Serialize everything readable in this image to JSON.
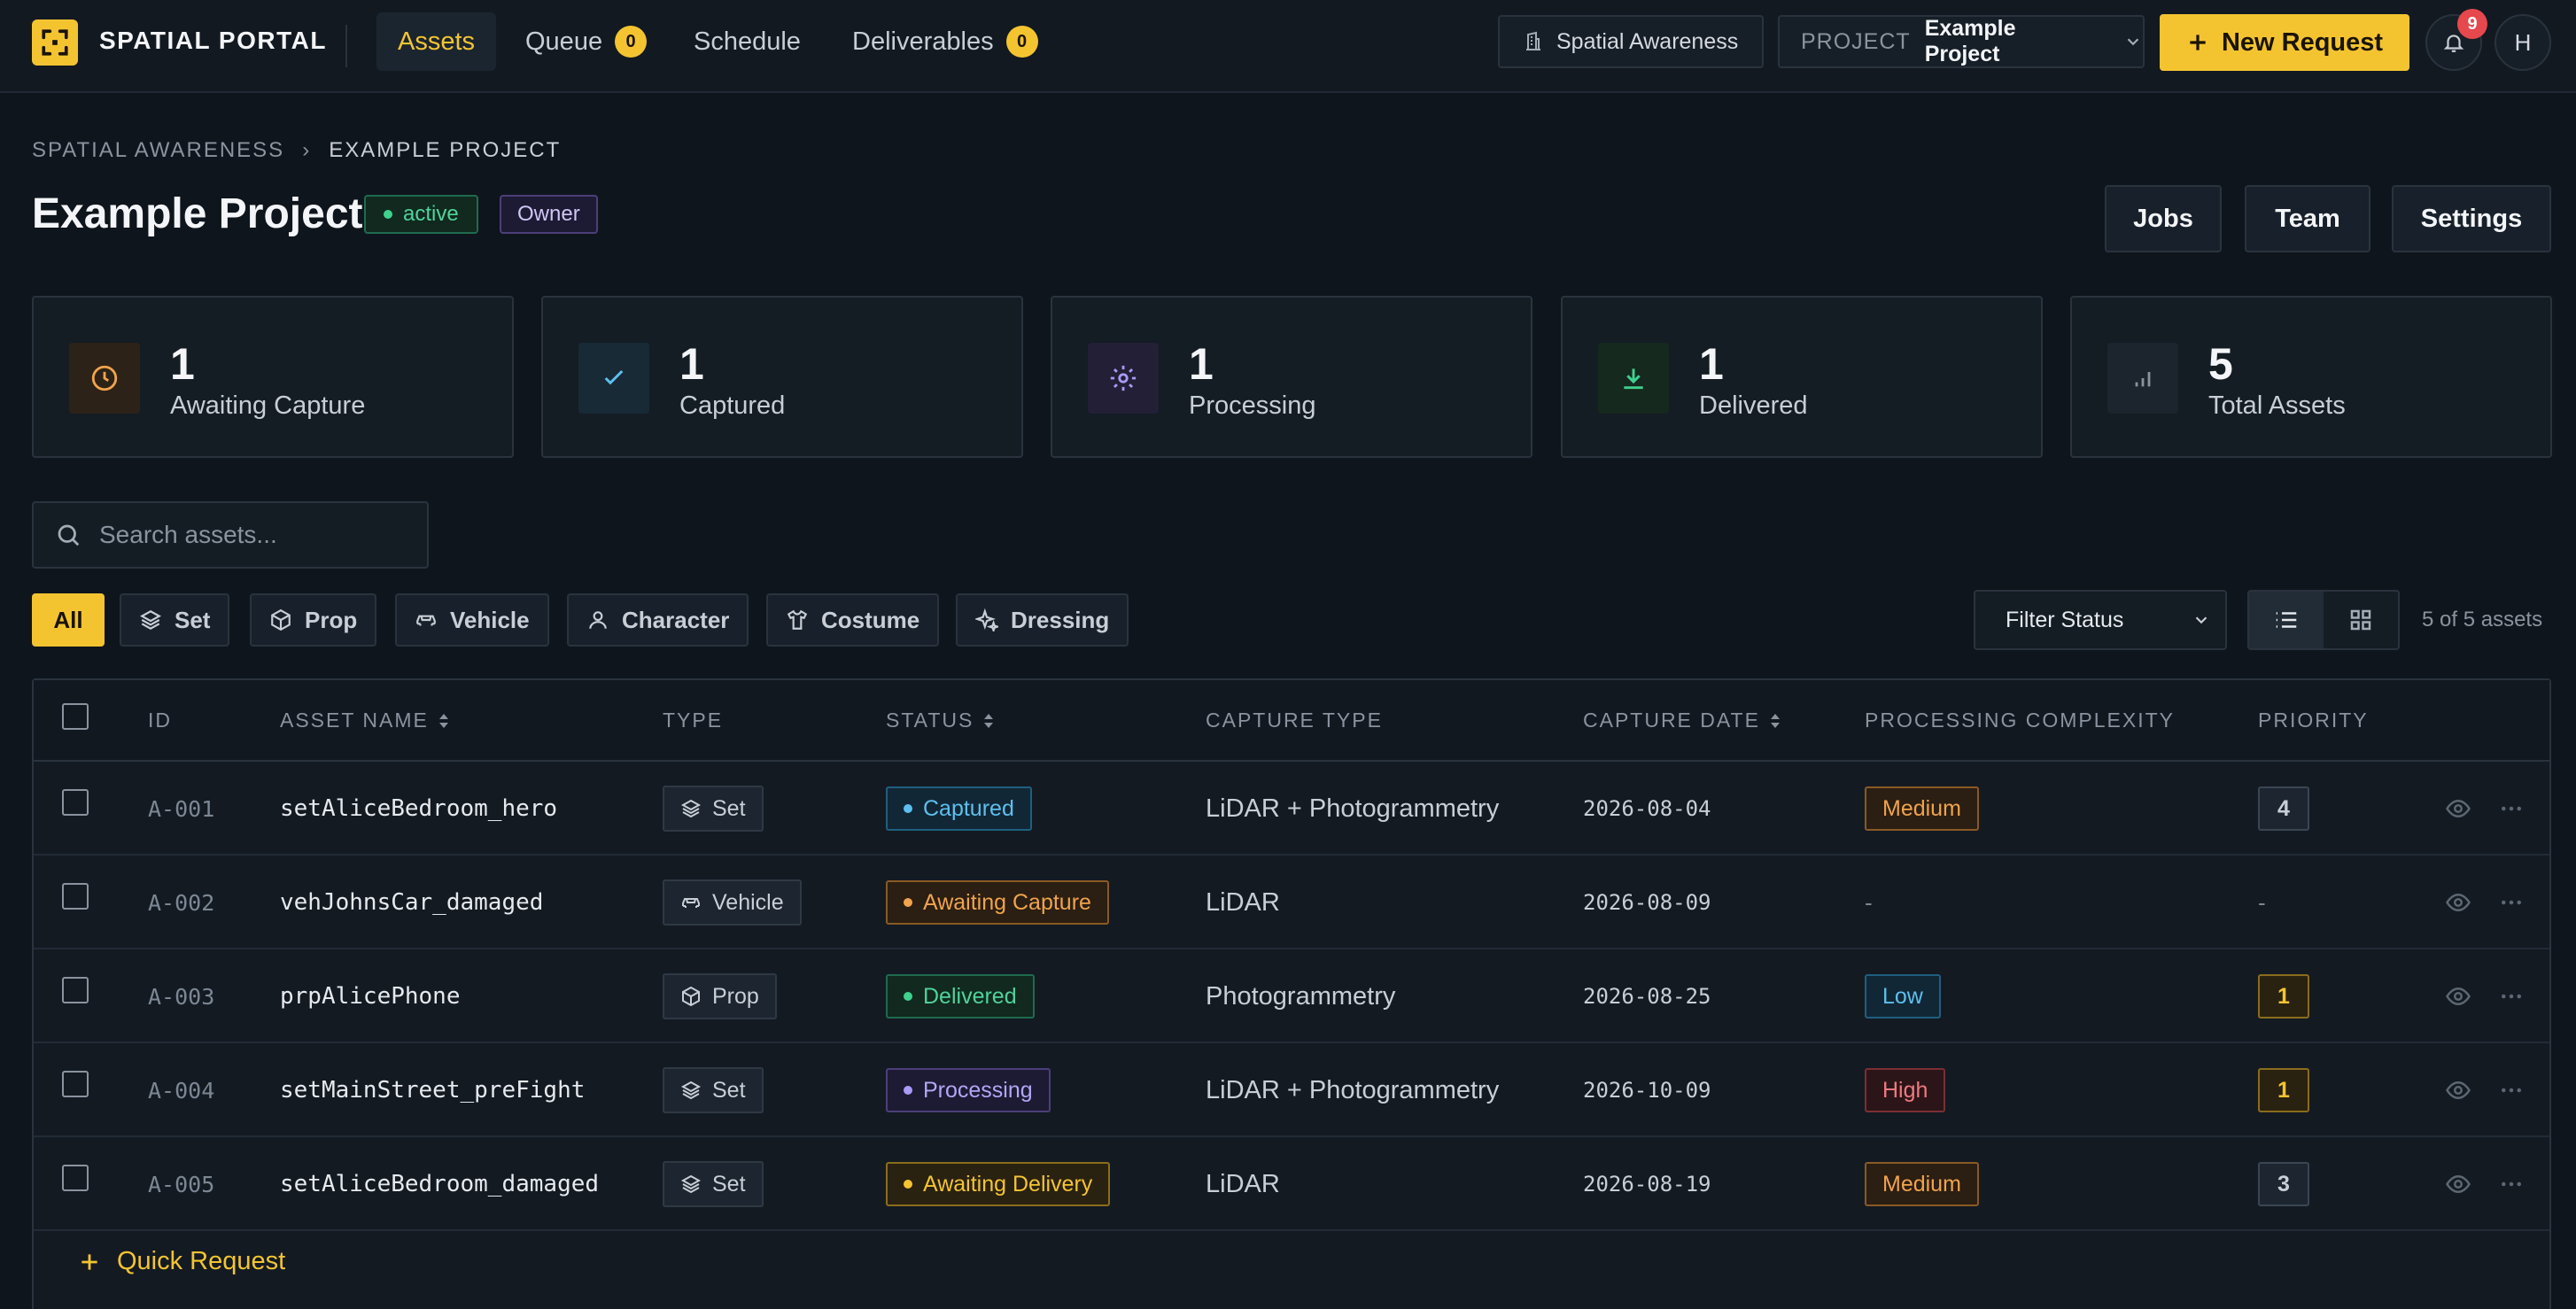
{
  "app": {
    "brand": "SPATIAL PORTAL"
  },
  "nav": {
    "tabs": [
      {
        "label": "Assets"
      },
      {
        "label": "Queue",
        "count": "0"
      },
      {
        "label": "Schedule"
      },
      {
        "label": "Deliverables",
        "count": "0"
      }
    ]
  },
  "topbar": {
    "org": "Spatial Awareness",
    "project_label": "PROJECT",
    "project_value": "Example Project",
    "new_request": "New Request",
    "notifications": "9",
    "avatar": "H"
  },
  "breadcrumb": [
    "SPATIAL AWARENESS",
    "EXAMPLE PROJECT"
  ],
  "breadcrumb_sep": "›",
  "project": {
    "title": "Example Project",
    "status": "active",
    "role": "Owner"
  },
  "header_buttons": [
    "Jobs",
    "Team",
    "Settings"
  ],
  "stats": [
    {
      "value": "1",
      "label": "Awaiting Capture",
      "icon": "clock-icon",
      "color": "#f0a44b"
    },
    {
      "value": "1",
      "label": "Captured",
      "icon": "check-icon",
      "color": "#5cc0ee"
    },
    {
      "value": "1",
      "label": "Processing",
      "icon": "gear-icon",
      "color": "#a99af5"
    },
    {
      "value": "1",
      "label": "Delivered",
      "icon": "download-icon",
      "color": "#3fd18e"
    },
    {
      "value": "5",
      "label": "Total Assets",
      "icon": "bar-chart-icon",
      "color": "#8a939e"
    }
  ],
  "search": {
    "placeholder": "Search assets..."
  },
  "filters": [
    "All",
    "Set",
    "Prop",
    "Vehicle",
    "Character",
    "Costume",
    "Dressing"
  ],
  "filter_status": "Filter Status",
  "asset_count": "5 of 5 assets",
  "table": {
    "columns": [
      "ID",
      "ASSET NAME",
      "TYPE",
      "STATUS",
      "CAPTURE TYPE",
      "CAPTURE DATE",
      "PROCESSING COMPLEXITY",
      "PRIORITY"
    ],
    "rows": [
      {
        "id": "A-001",
        "name": "setAliceBedroom_hero",
        "type": "Set",
        "status": "Captured",
        "capture_type": "LiDAR + Photogrammetry",
        "date": "2026-08-04",
        "complexity": "Medium",
        "priority": "4"
      },
      {
        "id": "A-002",
        "name": "vehJohnsCar_damaged",
        "type": "Vehicle",
        "status": "Awaiting Capture",
        "capture_type": "LiDAR",
        "date": "2026-08-09",
        "complexity": "-",
        "priority": "-"
      },
      {
        "id": "A-003",
        "name": "prpAlicePhone",
        "type": "Prop",
        "status": "Delivered",
        "capture_type": "Photogrammetry",
        "date": "2026-08-25",
        "complexity": "Low",
        "priority": "1"
      },
      {
        "id": "A-004",
        "name": "setMainStreet_preFight",
        "type": "Set",
        "status": "Processing",
        "capture_type": "LiDAR + Photogrammetry",
        "date": "2026-10-09",
        "complexity": "High",
        "priority": "1"
      },
      {
        "id": "A-005",
        "name": "setAliceBedroom_damaged",
        "type": "Set",
        "status": "Awaiting Delivery",
        "capture_type": "LiDAR",
        "date": "2026-08-19",
        "complexity": "Medium",
        "priority": "3"
      }
    ]
  },
  "quick_request": "Quick Request",
  "colors": {
    "accent": "#f4c430",
    "background": "#0f151c"
  }
}
